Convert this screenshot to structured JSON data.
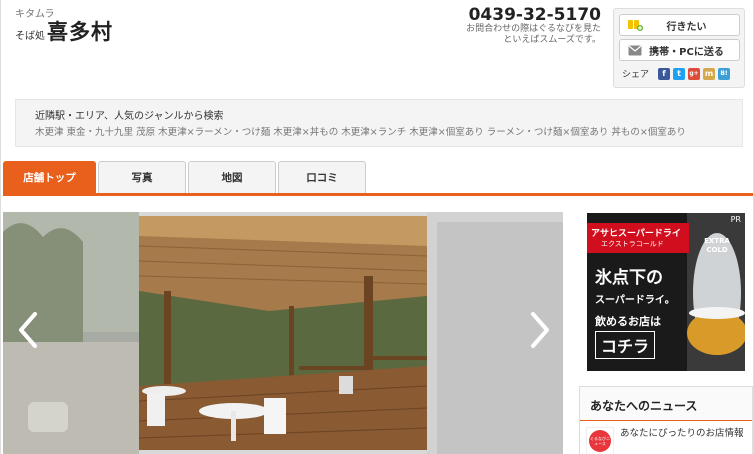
{
  "shop": {
    "kana": "キタムラ",
    "genre": "そば処",
    "name": "喜多村"
  },
  "contact": {
    "phone": "0439-32-5170",
    "note": "お問合わせの際はぐるなびを見たといえばスムーズです。"
  },
  "actions": {
    "wish_label": "行きたい",
    "send_label": "携帯・PCに送る",
    "share_label": "シェア",
    "share_icons": [
      {
        "name": "facebook-icon",
        "glyph": "f",
        "color": "#3b5998"
      },
      {
        "name": "twitter-icon",
        "glyph": "t",
        "color": "#1da1f2"
      },
      {
        "name": "google-plus-icon",
        "glyph": "g+",
        "color": "#dd4b39"
      },
      {
        "name": "mixi-icon",
        "glyph": "m",
        "color": "#d4a84b"
      },
      {
        "name": "hatena-bookmark-icon",
        "glyph": "B!",
        "color": "#3c9fd6"
      }
    ]
  },
  "search": {
    "title": "近隣駅・エリア、人気のジャンルから検索",
    "links": [
      "木更津",
      "東金・九十九里",
      "茂原",
      "木更津×ラーメン・つけ麺",
      "木更津×丼もの",
      "木更津×ランチ",
      "木更津×個室あり",
      "ラーメン・つけ麺×個室あり",
      "丼もの×個室あり"
    ]
  },
  "tabs": [
    "店舗トップ",
    "写真",
    "地図",
    "口コミ"
  ],
  "gallery": {
    "prev_icon": "chevron-left-icon",
    "next_icon": "chevron-right-icon"
  },
  "ad": {
    "badge": "PR",
    "brand": "アサヒスーパードライ",
    "sub": "エクストラコールド",
    "product": "EXTRA COLD",
    "headline1": "氷点下の",
    "headline2": "スーパードライ。",
    "headline3": "飲めるお店は",
    "headline4": "コチラ"
  },
  "news": {
    "title": "あなたへのニュース",
    "item_text": "あなたにぴったりのお店情報",
    "icon_label": "ぐるなびニュース"
  },
  "colors": {
    "accent": "#e8601c"
  }
}
